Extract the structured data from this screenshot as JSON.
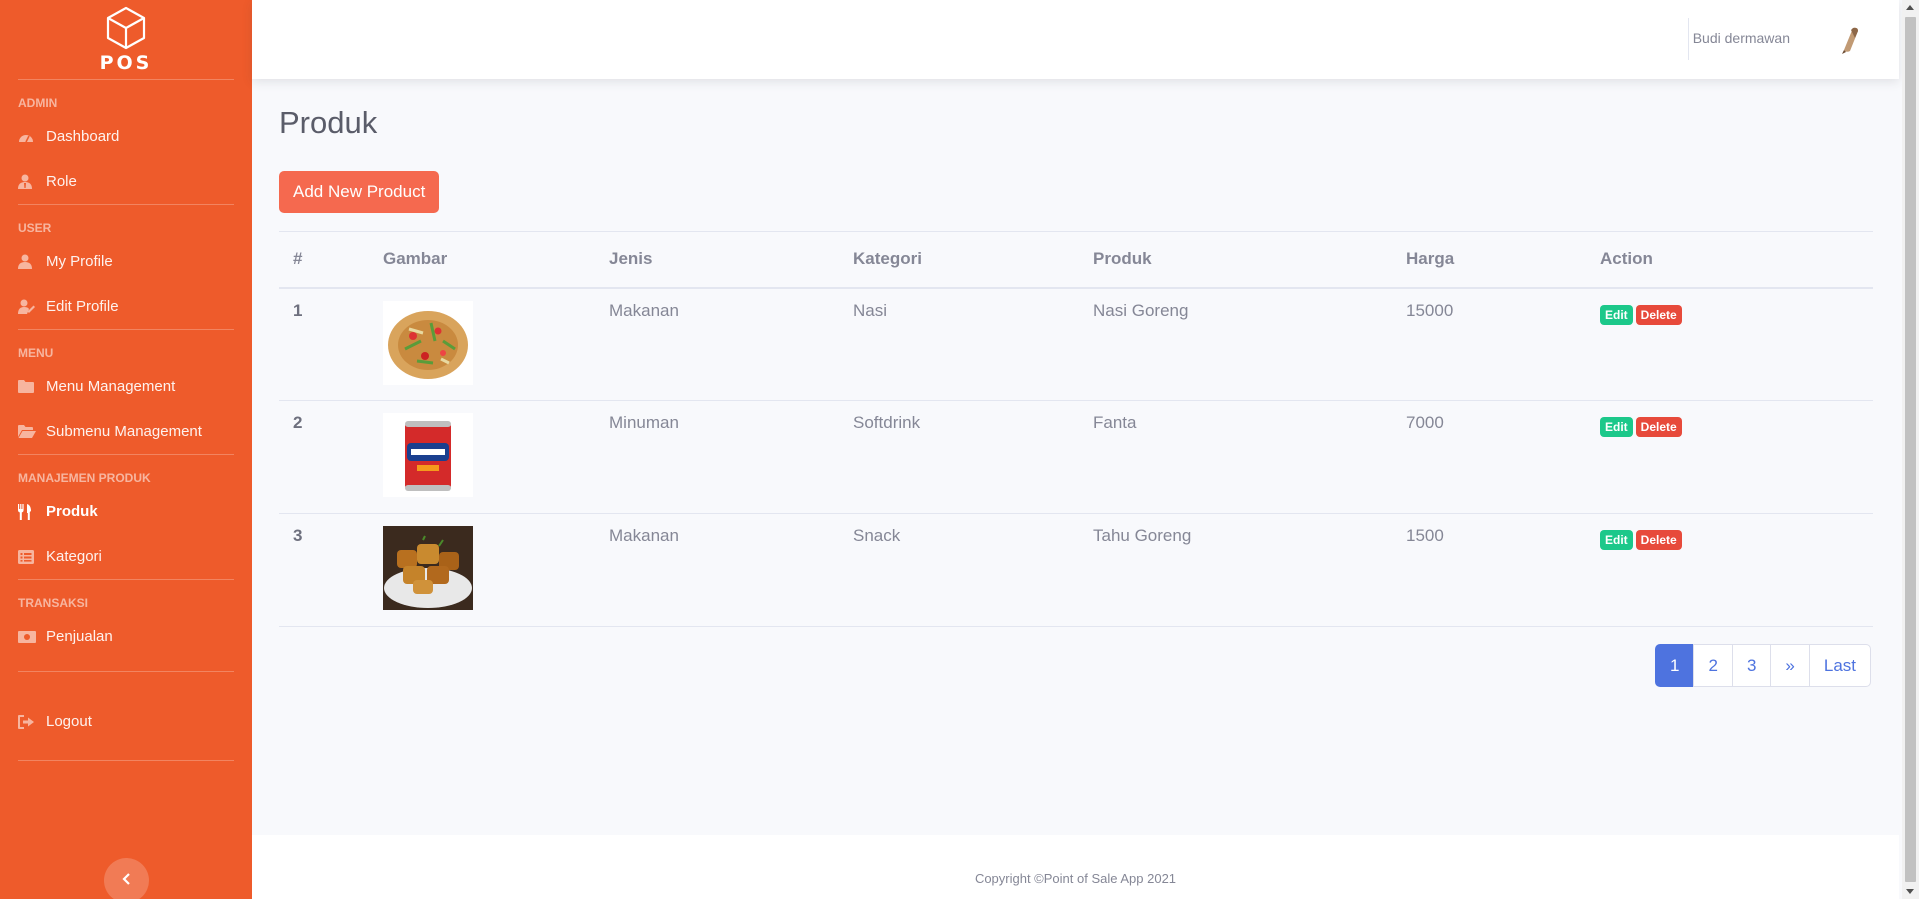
{
  "brand": {
    "text": "POS"
  },
  "sidebar": {
    "sections": [
      {
        "heading": "Admin",
        "items": [
          {
            "label": "Dashboard",
            "icon": "tachometer-icon"
          },
          {
            "label": "Role",
            "icon": "user-tie-icon"
          }
        ]
      },
      {
        "heading": "User",
        "items": [
          {
            "label": "My Profile",
            "icon": "user-icon"
          },
          {
            "label": "Edit Profile",
            "icon": "user-edit-icon"
          }
        ]
      },
      {
        "heading": "Menu",
        "items": [
          {
            "label": "Menu Management",
            "icon": "folder-icon"
          },
          {
            "label": "Submenu Management",
            "icon": "folder-open-icon"
          }
        ]
      },
      {
        "heading": "Manajemen Produk",
        "items": [
          {
            "label": "Produk",
            "icon": "utensils-icon",
            "active": true
          },
          {
            "label": "Kategori",
            "icon": "list-alt-icon"
          }
        ]
      },
      {
        "heading": "Transaksi",
        "items": [
          {
            "label": "Penjualan",
            "icon": "money-bill-icon"
          }
        ]
      }
    ],
    "logout": {
      "label": "Logout",
      "icon": "sign-out-icon"
    },
    "toggle_icon": "chevron-left-icon"
  },
  "topbar": {
    "user_name": "Budi dermawan"
  },
  "page": {
    "title": "Produk",
    "add_button": "Add New Product"
  },
  "table": {
    "headers": [
      "#",
      "Gambar",
      "Jenis",
      "Kategori",
      "Produk",
      "Harga",
      "Action"
    ],
    "rows": [
      {
        "no": "1",
        "jenis": "Makanan",
        "kategori": "Nasi",
        "produk": "Nasi Goreng",
        "harga": "15000",
        "image": "nasi-goreng-image"
      },
      {
        "no": "2",
        "jenis": "Minuman",
        "kategori": "Softdrink",
        "produk": "Fanta",
        "harga": "7000",
        "image": "fanta-can-image"
      },
      {
        "no": "3",
        "jenis": "Makanan",
        "kategori": "Snack",
        "produk": "Tahu Goreng",
        "harga": "1500",
        "image": "tahu-goreng-image"
      }
    ],
    "edit_label": "Edit",
    "delete_label": "Delete"
  },
  "pagination": {
    "pages": [
      "1",
      "2",
      "3"
    ],
    "next": "»",
    "last": "Last",
    "current": "1"
  },
  "footer": {
    "text": "Copyright ©Point of Sale App 2021"
  },
  "colors": {
    "sidebar": "#ee5b2b",
    "primary": "#4e73df",
    "success": "#1cc88a",
    "danger": "#e74a3b",
    "add_button": "#f5694f"
  }
}
